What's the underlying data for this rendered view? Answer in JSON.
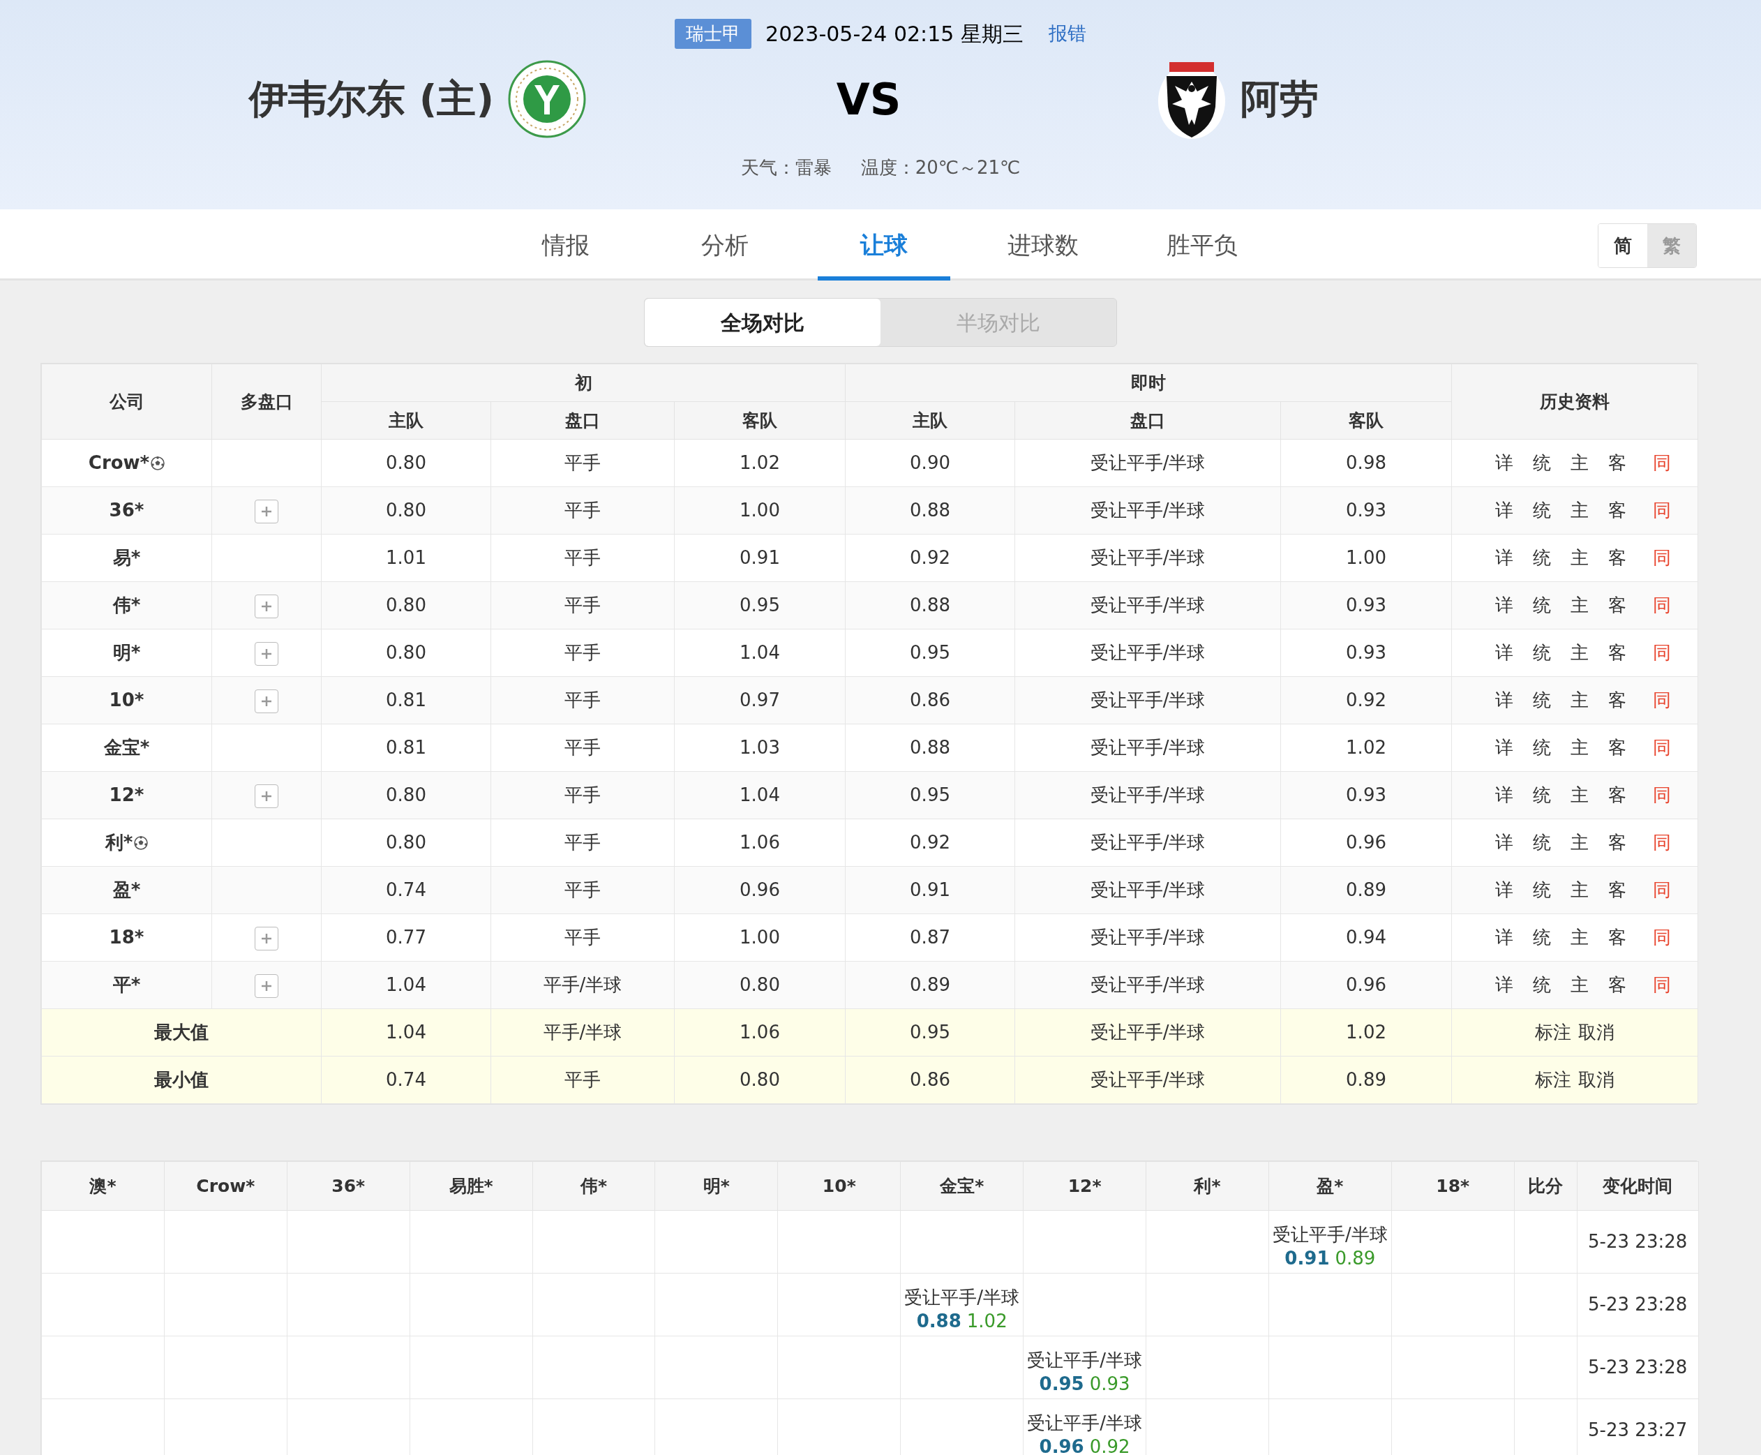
{
  "match": {
    "league": "瑞士甲",
    "datetime": "2023-05-24 02:15 星期三",
    "report_link": "报错",
    "home_team": "伊韦尔东 (主)",
    "vs": "VS",
    "away_team": "阿劳",
    "weather": "天气：雷暴",
    "temperature": "温度：20℃～21℃"
  },
  "tabs": [
    {
      "label": "情报",
      "selected": false
    },
    {
      "label": "分析",
      "selected": false
    },
    {
      "label": "让球",
      "selected": true
    },
    {
      "label": "进球数",
      "selected": false
    },
    {
      "label": "胜平负",
      "selected": false
    }
  ],
  "script_toggle": [
    {
      "label": "简",
      "selected": true
    },
    {
      "label": "繁",
      "selected": false
    }
  ],
  "segments": [
    {
      "label": "全场对比",
      "selected": true
    },
    {
      "label": "半场对比",
      "selected": false
    }
  ],
  "odds_table": {
    "headers": {
      "company": "公司",
      "multi": "多盘口",
      "initial": "初",
      "live": "即时",
      "history": "历史资料",
      "init_home": "主队",
      "init_line": "盘口",
      "init_away": "客队",
      "live_home": "主队",
      "live_line": "盘口",
      "live_away": "客队"
    },
    "rows": [
      {
        "company": "Crow*",
        "ball": true,
        "multi": false,
        "init_home": "0.80",
        "init_line": "平手",
        "init_away": "1.02",
        "live_home": "0.90",
        "live_line": "受让平手/半球",
        "live_away": "0.98",
        "links": [
          "详",
          "统",
          "主",
          "客",
          "同"
        ]
      },
      {
        "company": "36*",
        "ball": false,
        "multi": true,
        "init_home": "0.80",
        "init_line": "平手",
        "init_away": "1.00",
        "live_home": "0.88",
        "live_line": "受让平手/半球",
        "live_away": "0.93",
        "links": [
          "详",
          "统",
          "主",
          "客",
          "同"
        ]
      },
      {
        "company": "易*",
        "ball": false,
        "multi": false,
        "init_home": "1.01",
        "init_line": "平手",
        "init_away": "0.91",
        "live_home": "0.92",
        "live_line": "受让平手/半球",
        "live_away": "1.00",
        "links": [
          "详",
          "统",
          "主",
          "客",
          "同"
        ]
      },
      {
        "company": "伟*",
        "ball": false,
        "multi": true,
        "init_home": "0.80",
        "init_line": "平手",
        "init_away": "0.95",
        "live_home": "0.88",
        "live_line": "受让平手/半球",
        "live_away": "0.93",
        "links": [
          "详",
          "统",
          "主",
          "客",
          "同"
        ]
      },
      {
        "company": "明*",
        "ball": false,
        "multi": true,
        "init_home": "0.80",
        "init_line": "平手",
        "init_away": "1.04",
        "live_home": "0.95",
        "live_line": "受让平手/半球",
        "live_away": "0.93",
        "links": [
          "详",
          "统",
          "主",
          "客",
          "同"
        ]
      },
      {
        "company": "10*",
        "ball": false,
        "multi": true,
        "init_home": "0.81",
        "init_line": "平手",
        "init_away": "0.97",
        "live_home": "0.86",
        "live_line": "受让平手/半球",
        "live_away": "0.92",
        "links": [
          "详",
          "统",
          "主",
          "客",
          "同"
        ]
      },
      {
        "company": "金宝*",
        "ball": false,
        "multi": false,
        "init_home": "0.81",
        "init_line": "平手",
        "init_away": "1.03",
        "live_home": "0.88",
        "live_line": "受让平手/半球",
        "live_away": "1.02",
        "links": [
          "详",
          "统",
          "主",
          "客",
          "同"
        ]
      },
      {
        "company": "12*",
        "ball": false,
        "multi": true,
        "init_home": "0.80",
        "init_line": "平手",
        "init_away": "1.04",
        "live_home": "0.95",
        "live_line": "受让平手/半球",
        "live_away": "0.93",
        "links": [
          "详",
          "统",
          "主",
          "客",
          "同"
        ]
      },
      {
        "company": "利*",
        "ball": true,
        "multi": false,
        "init_home": "0.80",
        "init_line": "平手",
        "init_away": "1.06",
        "live_home": "0.92",
        "live_line": "受让平手/半球",
        "live_away": "0.96",
        "links": [
          "详",
          "统",
          "主",
          "客",
          "同"
        ]
      },
      {
        "company": "盈*",
        "ball": false,
        "multi": false,
        "init_home": "0.74",
        "init_line": "平手",
        "init_away": "0.96",
        "live_home": "0.91",
        "live_line": "受让平手/半球",
        "live_away": "0.89",
        "links": [
          "详",
          "统",
          "主",
          "客",
          "同"
        ]
      },
      {
        "company": "18*",
        "ball": false,
        "multi": true,
        "init_home": "0.77",
        "init_line": "平手",
        "init_away": "1.00",
        "live_home": "0.87",
        "live_line": "受让平手/半球",
        "live_away": "0.94",
        "links": [
          "详",
          "统",
          "主",
          "客",
          "同"
        ]
      },
      {
        "company": "平*",
        "ball": false,
        "multi": true,
        "init_home": "1.04",
        "init_line": "平手/半球",
        "init_away": "0.80",
        "live_home": "0.89",
        "live_line": "受让平手/半球",
        "live_away": "0.96",
        "links": [
          "详",
          "统",
          "主",
          "客",
          "同"
        ]
      }
    ],
    "summary": [
      {
        "label": "最大值",
        "init_home": "1.04",
        "init_line": "平手/半球",
        "init_away": "1.06",
        "live_home": "0.95",
        "live_line": "受让平手/半球",
        "live_away": "1.02",
        "actions": [
          "标注",
          "取消"
        ]
      },
      {
        "label": "最小值",
        "init_home": "0.74",
        "init_line": "平手",
        "init_away": "0.80",
        "live_home": "0.86",
        "live_line": "受让平手/半球",
        "live_away": "0.89",
        "actions": [
          "标注",
          "取消"
        ]
      }
    ]
  },
  "changes_table": {
    "columns": [
      "澳*",
      "Crow*",
      "36*",
      "易胜*",
      "伟*",
      "明*",
      "10*",
      "金宝*",
      "12*",
      "利*",
      "盈*",
      "18*",
      "比分",
      "变化时间"
    ],
    "rows": [
      {
        "cells": [
          null,
          null,
          null,
          null,
          null,
          null,
          null,
          null,
          null,
          null,
          {
            "line": "受让平手/半球",
            "home": "0.91",
            "away": "0.89"
          },
          null
        ],
        "time": "5-23 23:28"
      },
      {
        "cells": [
          null,
          null,
          null,
          null,
          null,
          null,
          null,
          {
            "line": "受让平手/半球",
            "home": "0.88",
            "away": "1.02"
          },
          null,
          null,
          null,
          null
        ],
        "time": "5-23 23:28"
      },
      {
        "cells": [
          null,
          null,
          null,
          null,
          null,
          null,
          null,
          null,
          {
            "line": "受让平手/半球",
            "home": "0.95",
            "away": "0.93"
          },
          null,
          null,
          null
        ],
        "time": "5-23 23:28"
      },
      {
        "cells": [
          null,
          null,
          null,
          null,
          null,
          null,
          null,
          null,
          {
            "line": "受让平手/半球",
            "home": "0.96",
            "away": "0.92"
          },
          null,
          null,
          null
        ],
        "time": "5-23 23:27"
      }
    ]
  }
}
